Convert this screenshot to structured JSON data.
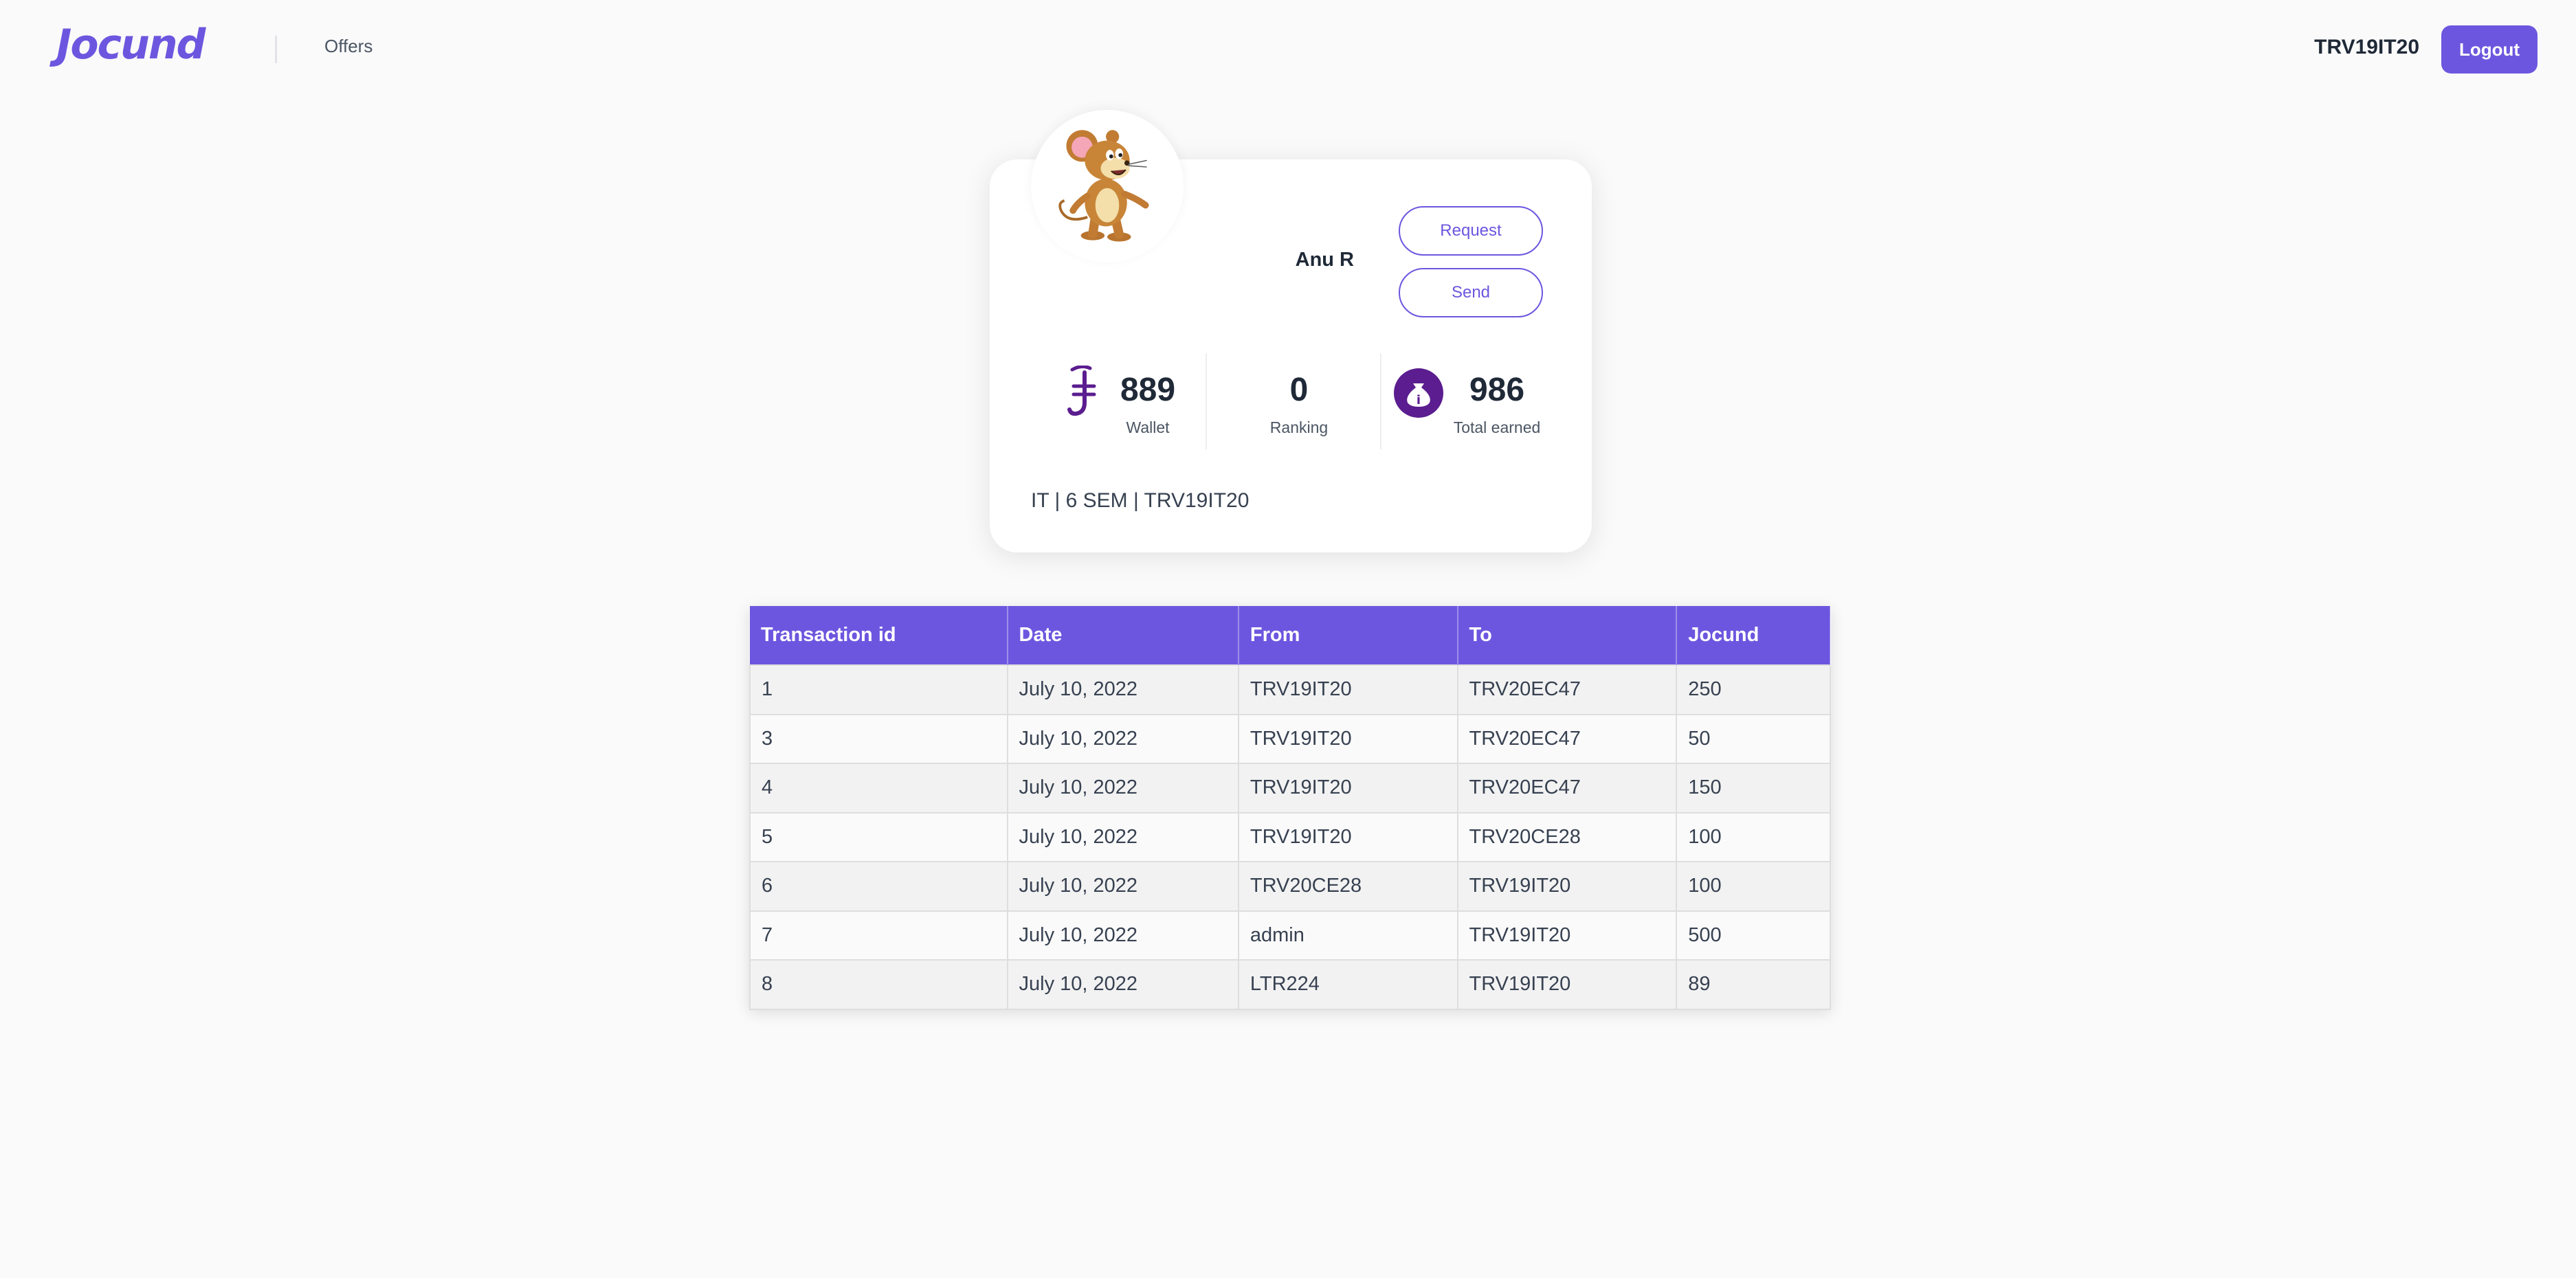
{
  "header": {
    "logo_text": "Jocund",
    "nav": {
      "offers": "Offers"
    },
    "user_id": "TRV19IT20",
    "logout_label": "Logout"
  },
  "profile": {
    "name": "Anu R",
    "request_label": "Request",
    "send_label": "Send",
    "stats": {
      "wallet": {
        "value": "889",
        "label": "Wallet",
        "icon": "jocund-currency-icon"
      },
      "ranking": {
        "value": "0",
        "label": "Ranking"
      },
      "total_earned": {
        "value": "986",
        "label": "Total earned",
        "icon": "money-bag-icon"
      }
    },
    "meta": "IT | 6 SEM | TRV19IT20",
    "avatar_icon": "mouse-avatar-icon"
  },
  "transactions": {
    "headers": {
      "id": "Transaction id",
      "date": "Date",
      "from": "From",
      "to": "To",
      "amount": "Jocund"
    },
    "rows": [
      {
        "id": "1",
        "date": "July 10, 2022",
        "from": "TRV19IT20",
        "to": "TRV20EC47",
        "amount": "250"
      },
      {
        "id": "3",
        "date": "July 10, 2022",
        "from": "TRV19IT20",
        "to": "TRV20EC47",
        "amount": "50"
      },
      {
        "id": "4",
        "date": "July 10, 2022",
        "from": "TRV19IT20",
        "to": "TRV20EC47",
        "amount": "150"
      },
      {
        "id": "5",
        "date": "July 10, 2022",
        "from": "TRV19IT20",
        "to": "TRV20CE28",
        "amount": "100"
      },
      {
        "id": "6",
        "date": "July 10, 2022",
        "from": "TRV20CE28",
        "to": "TRV19IT20",
        "amount": "100"
      },
      {
        "id": "7",
        "date": "July 10, 2022",
        "from": "admin",
        "to": "TRV19IT20",
        "amount": "500"
      },
      {
        "id": "8",
        "date": "July 10, 2022",
        "from": "LTR224",
        "to": "TRV19IT20",
        "amount": "89"
      }
    ]
  },
  "colors": {
    "accent": "#6d56df",
    "money_icon": "#5b1d8f",
    "background": "#fafafa"
  }
}
